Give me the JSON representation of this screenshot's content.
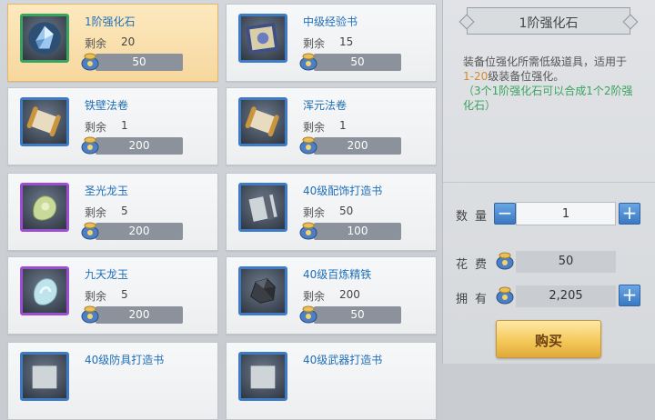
{
  "shop": {
    "remain_label": "剩余",
    "items": [
      {
        "name": "1阶强化石",
        "remain": "20",
        "price": "50",
        "selected": true,
        "frame": "green",
        "icon": "crystal-stone-icon"
      },
      {
        "name": "中级经验书",
        "remain": "15",
        "price": "50",
        "frame": "blue",
        "icon": "book-icon"
      },
      {
        "name": "铁壁法卷",
        "remain": "1",
        "price": "200",
        "frame": "blue",
        "icon": "scroll-icon"
      },
      {
        "name": "浑元法卷",
        "remain": "1",
        "price": "200",
        "frame": "blue",
        "icon": "scroll-icon"
      },
      {
        "name": "圣光龙玉",
        "remain": "5",
        "price": "200",
        "frame": "purple",
        "icon": "jade-icon"
      },
      {
        "name": "40级配饰打造书",
        "remain": "50",
        "price": "100",
        "frame": "blue",
        "icon": "blueprint-icon"
      },
      {
        "name": "九天龙玉",
        "remain": "5",
        "price": "200",
        "frame": "purple",
        "icon": "jade-icon"
      },
      {
        "name": "40级百炼精铁",
        "remain": "200",
        "price": "50",
        "frame": "blue",
        "icon": "ore-icon"
      },
      {
        "name": "40级防具打造书",
        "remain": "",
        "price": "",
        "frame": "blue",
        "icon": "blueprint-icon"
      },
      {
        "name": "40级武器打造书",
        "remain": "",
        "price": "",
        "frame": "blue",
        "icon": "blueprint-icon"
      }
    ]
  },
  "panel": {
    "title": "1阶强化石",
    "desc_pre": "装备位强化所需低级道具，适用于",
    "desc_hl": "1-20",
    "desc_post": "级装备位强化。",
    "desc_note": "（3个1阶强化石可以合成1个2阶强化石）",
    "qty_label": "数量",
    "qty_value": "1",
    "minus": "−",
    "plus": "+",
    "cost_label": "花费",
    "cost_value": "50",
    "own_label": "拥有",
    "own_value": "2,205",
    "buy_label": "购买"
  },
  "colors": {
    "accent": "#3a78c3",
    "gold": "#f4c95a",
    "name_blue": "#1f6fb8"
  }
}
